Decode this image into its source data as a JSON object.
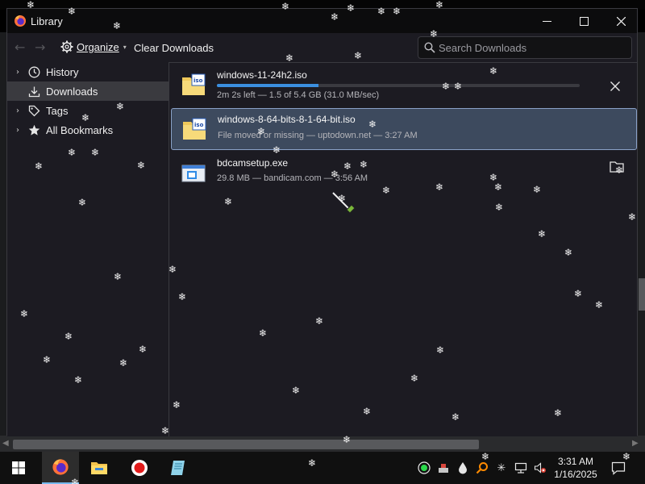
{
  "window": {
    "title": "Library"
  },
  "toolbar": {
    "organize_label": "Organize",
    "clear_downloads_label": "Clear Downloads",
    "search_placeholder": "Search Downloads"
  },
  "sidebar": {
    "items": [
      {
        "label": "History",
        "icon": "clock-icon",
        "expandable": true
      },
      {
        "label": "Downloads",
        "icon": "download-icon",
        "expandable": false,
        "selected": true
      },
      {
        "label": "Tags",
        "icon": "tag-icon",
        "expandable": true
      },
      {
        "label": "All Bookmarks",
        "icon": "star-icon",
        "expandable": true
      }
    ]
  },
  "downloads": [
    {
      "name": "windows-11-24h2.iso",
      "status": "2m 2s left — 1.5 of 5.4 GB (31.0 MB/sec)",
      "progress": 0.28,
      "icon": "iso-file-icon",
      "action": "cancel"
    },
    {
      "name": "windows-8-64-bits-8-1-64-bit.iso",
      "status": "File moved or missing — uptodown.net — 3:27 AM",
      "icon": "iso-file-icon",
      "selected": true
    },
    {
      "name": "bdcamsetup.exe",
      "status": "29.8 MB — bandicam.com — 3:56 AM",
      "icon": "exe-file-icon",
      "action": "open-folder"
    }
  ],
  "taskbar": {
    "apps": [
      "windows-start-icon",
      "firefox-icon",
      "file-explorer-icon",
      "record-icon",
      "notepad-icon"
    ],
    "time": "3:31 AM",
    "date": "1/16/2025"
  },
  "colors": {
    "accent": "#3b8fe0",
    "selection_bg": "#3d4a5e",
    "selection_border": "#8aa2c8",
    "window_bg": "#1c1b22",
    "titlebar_bg": "#0c0c0d"
  }
}
